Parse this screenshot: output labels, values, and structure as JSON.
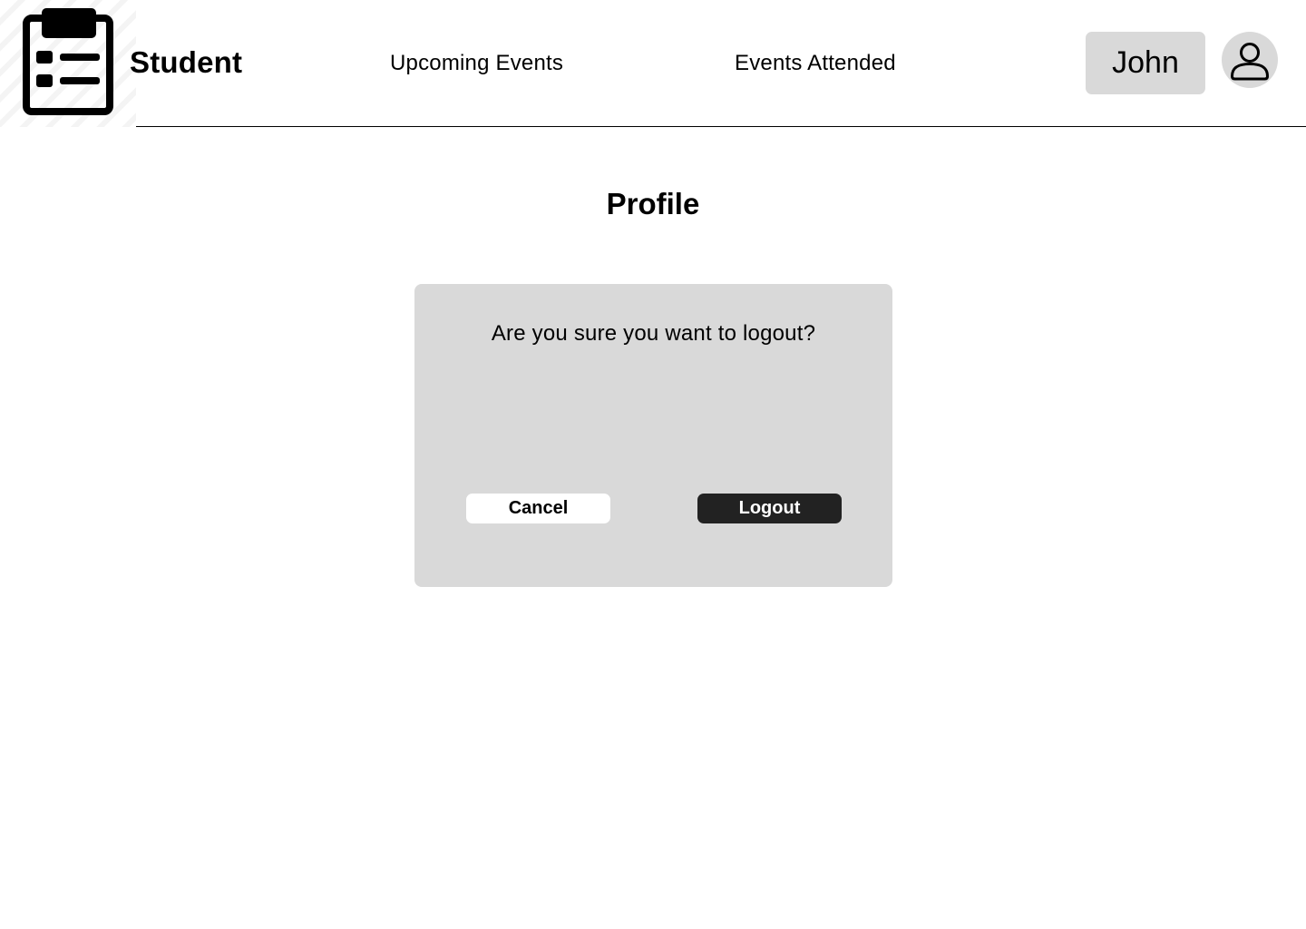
{
  "header": {
    "app_title": "Student",
    "logo_icon": "clipboard-list-icon",
    "nav": {
      "upcoming_label": "Upcoming Events",
      "attended_label": "Events Attended"
    },
    "user_name": "John",
    "avatar_icon": "user-icon"
  },
  "main": {
    "page_title": "Profile"
  },
  "dialog": {
    "message": "Are you sure you want to logout?",
    "cancel_label": "Cancel",
    "logout_label": "Logout"
  },
  "colors": {
    "chip_background": "#d9d9d9",
    "dialog_background": "#d9d9d9",
    "primary_button": "#222222"
  }
}
